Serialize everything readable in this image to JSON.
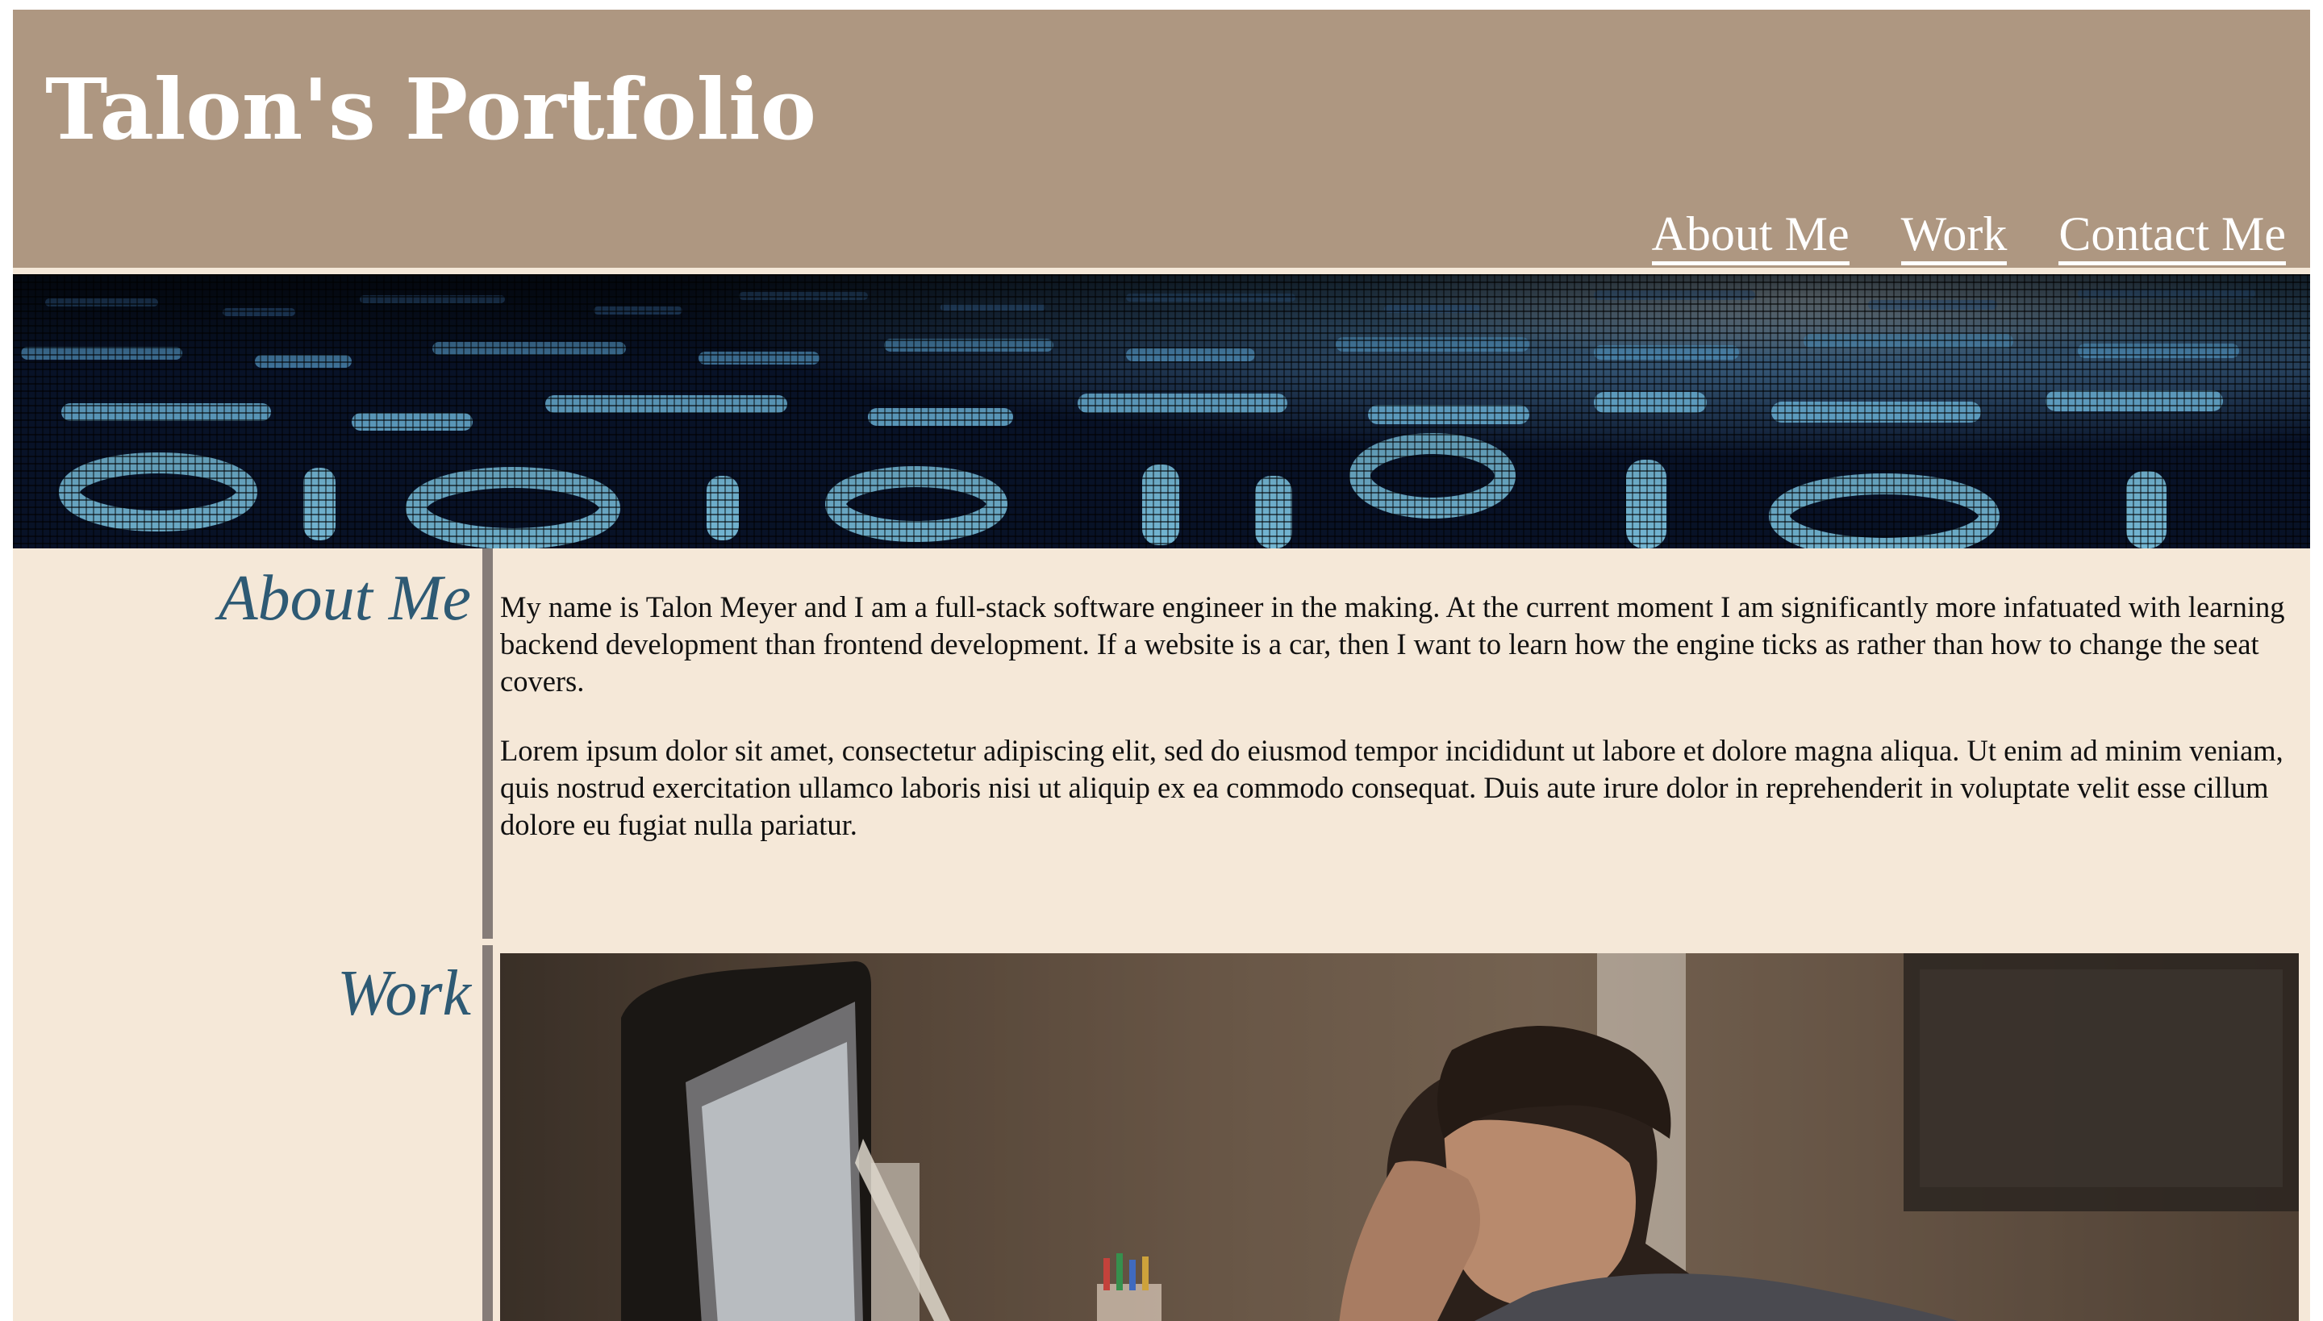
{
  "header": {
    "title": "Talon's Portfolio",
    "nav": [
      {
        "label": "About Me"
      },
      {
        "label": "Work"
      },
      {
        "label": "Contact Me"
      }
    ]
  },
  "about": {
    "heading": "About Me",
    "paragraphs": [
      "My name is Talon Meyer and I am a full-stack software engineer in the making. At the current moment I am significantly more infatuated with learning backend development than frontend development. If a website is a car, then I want to learn how the engine ticks as rather than how to change the seat covers.",
      "Lorem ipsum dolor sit amet, consectetur adipiscing elit, sed do eiusmod tempor incididunt ut labore et dolore magna aliqua. Ut enim ad minim veniam, quis nostrud exercitation ullamco laboris nisi ut aliquip ex ea commodo consequat. Duis aute irure dolor in reprehenderit in voluptate velit esse cillum dolore eu fugiat nulla pariatur."
    ]
  },
  "work": {
    "heading": "Work"
  },
  "colors": {
    "header_bg": "#ae9781",
    "page_bg": "#f5e8d8",
    "heading_blue": "#2e5a74",
    "divider": "#857c78"
  }
}
